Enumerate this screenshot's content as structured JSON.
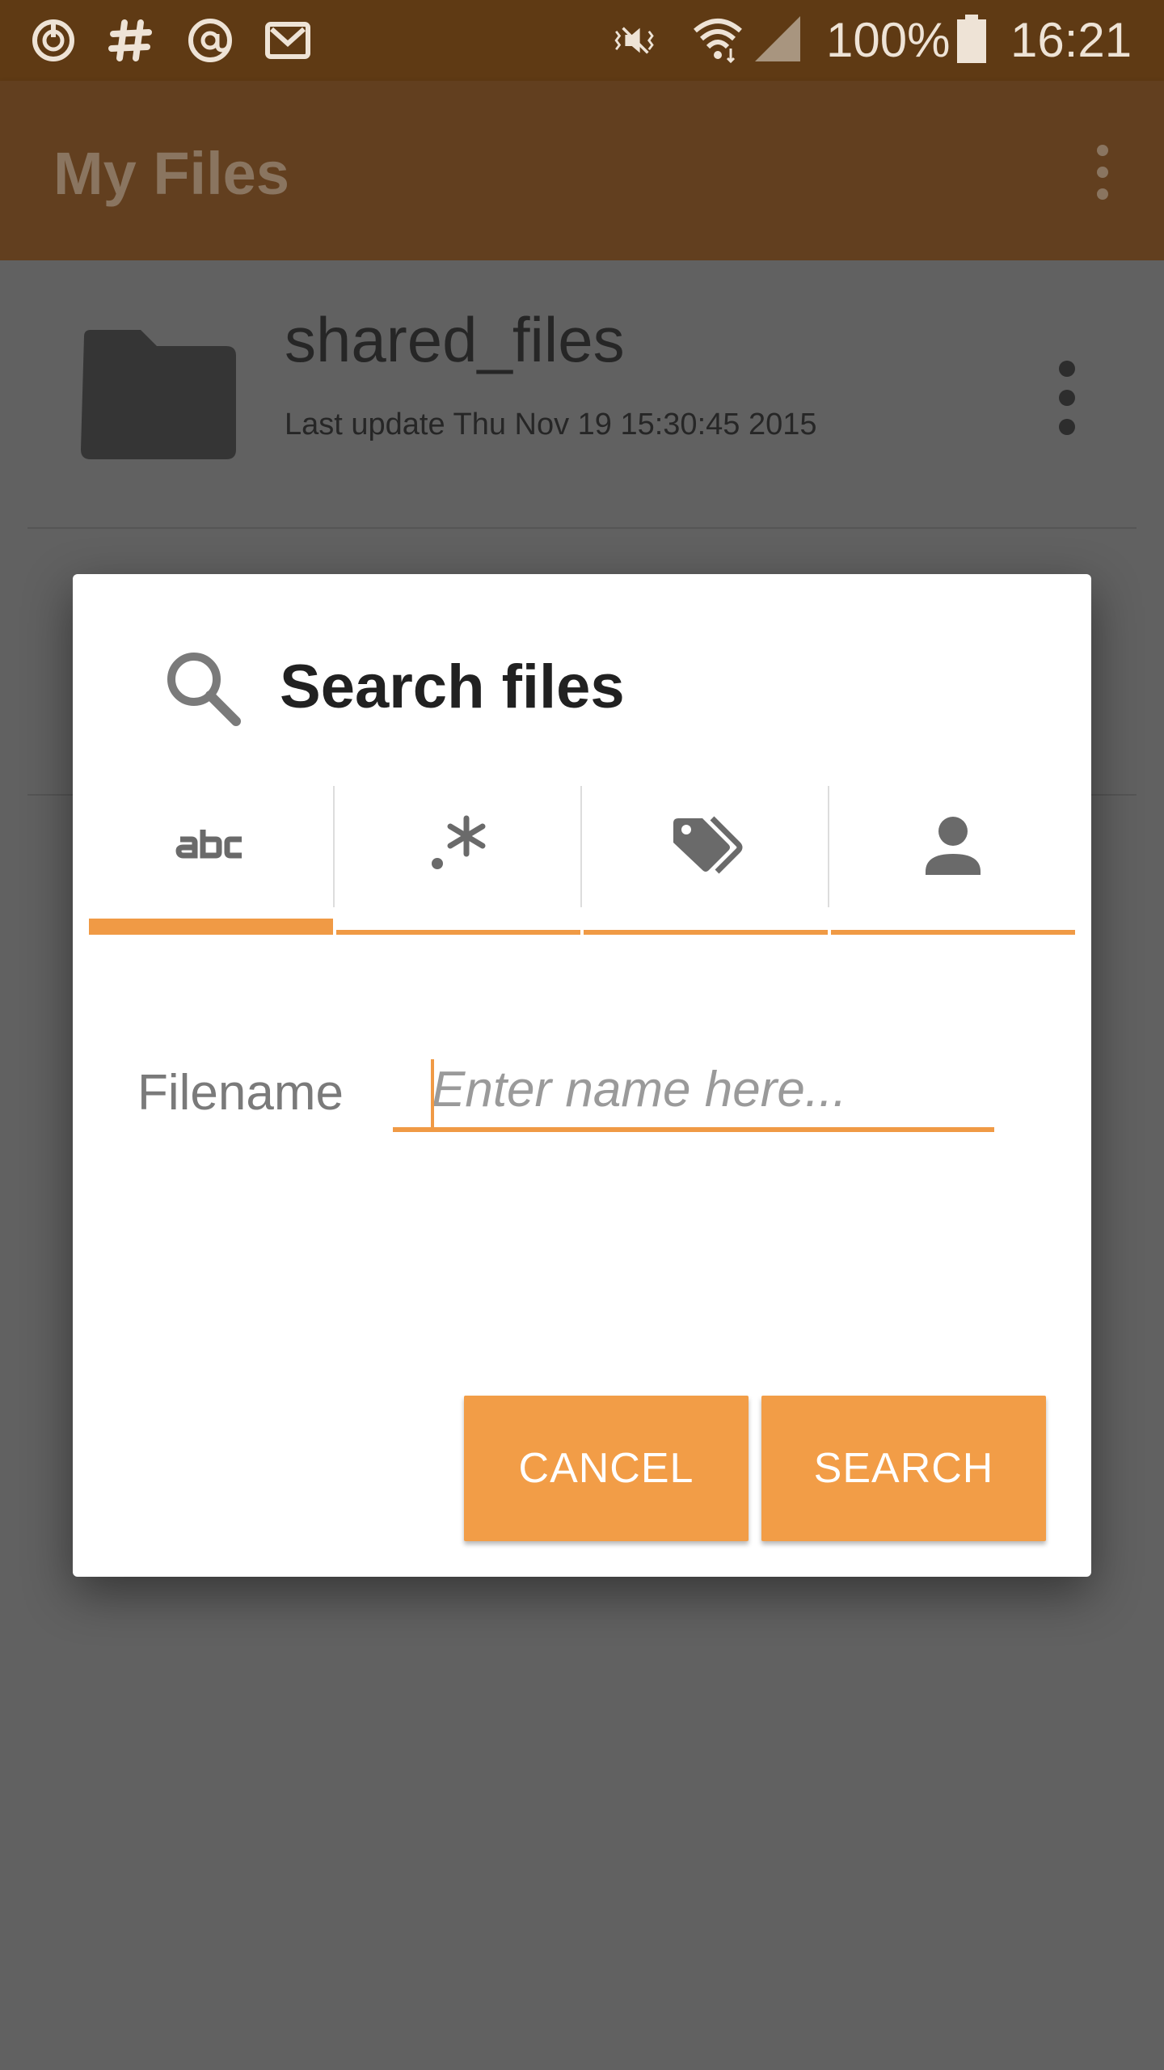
{
  "status_bar": {
    "battery": "100%",
    "time": "16:21",
    "icons": [
      "sync-icon",
      "hash-icon",
      "at-icon",
      "mail-icon",
      "vibrate-icon",
      "wifi-icon",
      "signal-icon",
      "battery-icon"
    ]
  },
  "app_bar": {
    "title": "My Files",
    "menu_icon": "overflow-menu-icon"
  },
  "list": {
    "items": [
      {
        "name": "shared_files",
        "subtitle": "Last update Thu Nov 19 15:30:45 2015",
        "icon": "folder-icon"
      }
    ]
  },
  "dialog": {
    "title": "Search files",
    "title_icon": "search-icon",
    "tabs": [
      {
        "icon": "abc-text-icon",
        "selected": true
      },
      {
        "icon": "regex-icon",
        "selected": false
      },
      {
        "icon": "tag-icon",
        "selected": false
      },
      {
        "icon": "person-icon",
        "selected": false
      }
    ],
    "field_label": "Filename",
    "field_placeholder": "Enter name here...",
    "field_value": "",
    "cancel_label": "CANCEL",
    "search_label": "SEARCH"
  },
  "colors": {
    "accent": "#f29d47",
    "status_bar": "#5f3a14",
    "app_bar": "#623f1f",
    "scrim": "#616161"
  }
}
